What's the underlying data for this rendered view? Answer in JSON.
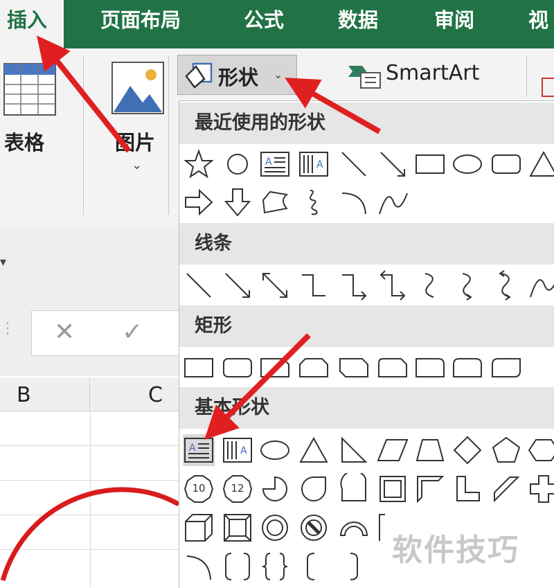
{
  "ribbon": {
    "tabs": [
      {
        "label": "插入",
        "active": true
      },
      {
        "label": "页面布局"
      },
      {
        "label": "公式"
      },
      {
        "label": "数据"
      },
      {
        "label": "审阅"
      },
      {
        "label": "视"
      }
    ],
    "table_label": "表格",
    "picture_label": "图片",
    "shapes_label": "形状",
    "smartart_label": "SmartArt"
  },
  "sheet": {
    "col_b": "B",
    "col_c": "C"
  },
  "shapes_menu": {
    "recent_header": "最近使用的形状",
    "lines_header": "线条",
    "rect_header": "矩形",
    "basic_header": "基本形状",
    "octagon_number": "12",
    "decagon_number": "10"
  },
  "watermark": "软件技巧",
  "colors": {
    "ribbon_green": "#217346",
    "arrow_red": "#e02020"
  }
}
